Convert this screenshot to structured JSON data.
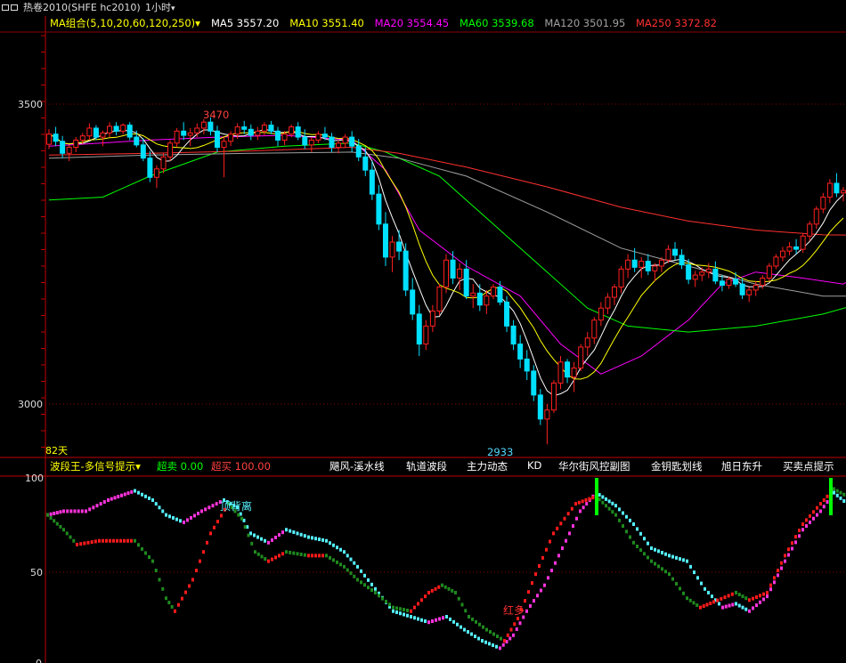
{
  "titlebar": {
    "symbol_title": "热卷2010(SHFE hc2010)",
    "period": "1小时",
    "period_caret": "▾"
  },
  "ma_legend": {
    "combo": "MA组合(5,10,20,60,120,250)",
    "caret": "▾",
    "items": [
      {
        "label": "MA5 3557.20",
        "color": "#ffffff"
      },
      {
        "label": "MA10 3551.40",
        "color": "#ffff00"
      },
      {
        "label": "MA20 3554.45",
        "color": "#ff00ff"
      },
      {
        "label": "MA60 3539.68",
        "color": "#00ff00"
      },
      {
        "label": "MA120 3501.95",
        "color": "#a0a0a0"
      },
      {
        "label": "MA250 3372.82",
        "color": "#ff3030"
      }
    ]
  },
  "price_axis": {
    "labels": [
      "3500",
      "3000"
    ]
  },
  "annotations": {
    "high": "3470",
    "low": "2933",
    "days": "82天"
  },
  "indicator": {
    "name": "波段王-多信号提示",
    "caret": "▾",
    "oversold": "超卖 0.00",
    "overbought": "超买 100.00",
    "axis_labels": [
      "100",
      "50",
      "0"
    ],
    "marks": {
      "top_divergence": "顶背离",
      "red": "红多"
    }
  },
  "tabs": [
    "飓风-溪水线",
    "轨道波段",
    "主力动态",
    "KD",
    "华尔街风控副图",
    "金钥匙划线",
    "旭日东升",
    "买卖点提示"
  ],
  "colors": {
    "up": "#ff2020",
    "down": "#00e0ff",
    "grid": "#8a0000",
    "axis": "#c00000",
    "text_red": "#ff4040",
    "magenta": "#ff33dd",
    "green": "#1f8a1f",
    "cyan": "#55f0ff"
  },
  "chart_data": {
    "type": "candlestick",
    "interval": "1 hour",
    "ylim": [
      2900,
      3650
    ],
    "candles": [
      [
        3433,
        3458,
        3425,
        3450
      ],
      [
        3450,
        3462,
        3430,
        3438
      ],
      [
        3438,
        3447,
        3410,
        3418
      ],
      [
        3418,
        3432,
        3405,
        3428
      ],
      [
        3428,
        3445,
        3420,
        3440
      ],
      [
        3440,
        3452,
        3433,
        3447
      ],
      [
        3447,
        3468,
        3440,
        3460
      ],
      [
        3460,
        3465,
        3440,
        3445
      ],
      [
        3445,
        3456,
        3430,
        3452
      ],
      [
        3452,
        3470,
        3445,
        3463
      ],
      [
        3463,
        3470,
        3448,
        3455
      ],
      [
        3455,
        3468,
        3450,
        3465
      ],
      [
        3465,
        3470,
        3440,
        3445
      ],
      [
        3445,
        3456,
        3428,
        3432
      ],
      [
        3432,
        3443,
        3405,
        3410
      ],
      [
        3410,
        3422,
        3370,
        3378
      ],
      [
        3378,
        3398,
        3360,
        3392
      ],
      [
        3392,
        3418,
        3385,
        3412
      ],
      [
        3412,
        3440,
        3405,
        3435
      ],
      [
        3435,
        3460,
        3428,
        3455
      ],
      [
        3455,
        3470,
        3440,
        3448
      ],
      [
        3448,
        3460,
        3430,
        3452
      ],
      [
        3452,
        3468,
        3445,
        3460
      ],
      [
        3460,
        3475,
        3450,
        3470
      ],
      [
        3470,
        3478,
        3448,
        3455
      ],
      [
        3455,
        3464,
        3420,
        3428
      ],
      [
        3428,
        3445,
        3378,
        3438
      ],
      [
        3438,
        3455,
        3430,
        3450
      ],
      [
        3450,
        3468,
        3442,
        3462
      ],
      [
        3462,
        3472,
        3450,
        3458
      ],
      [
        3458,
        3466,
        3440,
        3448
      ],
      [
        3448,
        3462,
        3440,
        3455
      ],
      [
        3455,
        3470,
        3448,
        3465
      ],
      [
        3465,
        3472,
        3450,
        3455
      ],
      [
        3455,
        3462,
        3430,
        3440
      ],
      [
        3440,
        3455,
        3432,
        3450
      ],
      [
        3450,
        3466,
        3445,
        3462
      ],
      [
        3462,
        3470,
        3440,
        3445
      ],
      [
        3445,
        3458,
        3425,
        3432
      ],
      [
        3432,
        3445,
        3420,
        3440
      ],
      [
        3440,
        3455,
        3435,
        3450
      ],
      [
        3450,
        3462,
        3440,
        3445
      ],
      [
        3445,
        3452,
        3420,
        3428
      ],
      [
        3428,
        3440,
        3418,
        3435
      ],
      [
        3435,
        3450,
        3428,
        3445
      ],
      [
        3445,
        3455,
        3420,
        3430
      ],
      [
        3430,
        3442,
        3405,
        3412
      ],
      [
        3412,
        3428,
        3380,
        3390
      ],
      [
        3390,
        3405,
        3340,
        3350
      ],
      [
        3350,
        3365,
        3290,
        3300
      ],
      [
        3300,
        3320,
        3230,
        3245
      ],
      [
        3245,
        3280,
        3220,
        3270
      ],
      [
        3270,
        3290,
        3240,
        3255
      ],
      [
        3255,
        3268,
        3180,
        3190
      ],
      [
        3190,
        3210,
        3140,
        3150
      ],
      [
        3150,
        3165,
        3080,
        3100
      ],
      [
        3100,
        3140,
        3090,
        3130
      ],
      [
        3130,
        3165,
        3120,
        3155
      ],
      [
        3155,
        3200,
        3148,
        3195
      ],
      [
        3195,
        3250,
        3185,
        3240
      ],
      [
        3240,
        3255,
        3200,
        3210
      ],
      [
        3210,
        3235,
        3190,
        3225
      ],
      [
        3225,
        3240,
        3175,
        3180
      ],
      [
        3180,
        3200,
        3160,
        3185
      ],
      [
        3185,
        3200,
        3155,
        3165
      ],
      [
        3165,
        3190,
        3150,
        3180
      ],
      [
        3180,
        3200,
        3175,
        3195
      ],
      [
        3195,
        3205,
        3165,
        3170
      ],
      [
        3170,
        3180,
        3120,
        3130
      ],
      [
        3130,
        3140,
        3090,
        3100
      ],
      [
        3100,
        3115,
        3060,
        3075
      ],
      [
        3075,
        3090,
        3040,
        3055
      ],
      [
        3055,
        3065,
        3005,
        3015
      ],
      [
        3015,
        3025,
        2965,
        2975
      ],
      [
        2975,
        3000,
        2933,
        2990
      ],
      [
        2990,
        3040,
        2985,
        3035
      ],
      [
        3035,
        3080,
        3025,
        3070
      ],
      [
        3070,
        3075,
        3035,
        3045
      ],
      [
        3045,
        3070,
        3020,
        3060
      ],
      [
        3060,
        3100,
        3055,
        3095
      ],
      [
        3095,
        3120,
        3080,
        3110
      ],
      [
        3110,
        3145,
        3100,
        3140
      ],
      [
        3140,
        3170,
        3130,
        3160
      ],
      [
        3160,
        3185,
        3150,
        3178
      ],
      [
        3178,
        3200,
        3165,
        3195
      ],
      [
        3195,
        3230,
        3185,
        3225
      ],
      [
        3225,
        3250,
        3210,
        3240
      ],
      [
        3240,
        3260,
        3220,
        3228
      ],
      [
        3228,
        3245,
        3210,
        3238
      ],
      [
        3238,
        3250,
        3215,
        3222
      ],
      [
        3222,
        3235,
        3205,
        3230
      ],
      [
        3230,
        3245,
        3220,
        3240
      ],
      [
        3240,
        3265,
        3235,
        3258
      ],
      [
        3258,
        3270,
        3240,
        3248
      ],
      [
        3248,
        3258,
        3225,
        3232
      ],
      [
        3232,
        3242,
        3200,
        3208
      ],
      [
        3208,
        3222,
        3195,
        3215
      ],
      [
        3215,
        3228,
        3205,
        3220
      ],
      [
        3220,
        3235,
        3210,
        3225
      ],
      [
        3225,
        3238,
        3200,
        3205
      ],
      [
        3205,
        3215,
        3188,
        3198
      ],
      [
        3198,
        3212,
        3192,
        3208
      ],
      [
        3208,
        3220,
        3195,
        3200
      ],
      [
        3200,
        3210,
        3175,
        3182
      ],
      [
        3182,
        3195,
        3170,
        3190
      ],
      [
        3190,
        3205,
        3180,
        3198
      ],
      [
        3198,
        3215,
        3192,
        3210
      ],
      [
        3210,
        3235,
        3205,
        3230
      ],
      [
        3230,
        3250,
        3225,
        3245
      ],
      [
        3245,
        3262,
        3238,
        3255
      ],
      [
        3255,
        3270,
        3248,
        3262
      ],
      [
        3262,
        3275,
        3250,
        3258
      ],
      [
        3258,
        3285,
        3252,
        3280
      ],
      [
        3280,
        3305,
        3272,
        3300
      ],
      [
        3300,
        3330,
        3292,
        3325
      ],
      [
        3325,
        3352,
        3318,
        3345
      ],
      [
        3345,
        3375,
        3335,
        3368
      ],
      [
        3368,
        3385,
        3345,
        3352
      ],
      [
        3352,
        3362,
        3338,
        3356
      ]
    ],
    "ma_series": [
      {
        "name": "MA20",
        "color": "#ff00ff",
        "points": [
          [
            0,
            3430
          ],
          [
            15,
            3440
          ],
          [
            25,
            3445
          ],
          [
            35,
            3448
          ],
          [
            45,
            3440
          ],
          [
            50,
            3390
          ],
          [
            55,
            3290
          ],
          [
            62,
            3230
          ],
          [
            70,
            3180
          ],
          [
            76,
            3100
          ],
          [
            82,
            3050
          ],
          [
            88,
            3080
          ],
          [
            95,
            3140
          ],
          [
            100,
            3200
          ],
          [
            105,
            3220
          ],
          [
            112,
            3210
          ],
          [
            118,
            3200
          ],
          [
            124,
            3240
          ],
          [
            126,
            3270
          ]
        ]
      },
      {
        "name": "MA60",
        "color": "#00ff00",
        "points": [
          [
            0,
            3340
          ],
          [
            8,
            3345
          ],
          [
            15,
            3380
          ],
          [
            25,
            3420
          ],
          [
            35,
            3430
          ],
          [
            45,
            3435
          ],
          [
            50,
            3420
          ],
          [
            58,
            3380
          ],
          [
            66,
            3300
          ],
          [
            74,
            3220
          ],
          [
            80,
            3160
          ],
          [
            86,
            3130
          ],
          [
            95,
            3120
          ],
          [
            105,
            3130
          ],
          [
            115,
            3150
          ],
          [
            126,
            3185
          ]
        ]
      },
      {
        "name": "MA120",
        "color": "#a0a0a0",
        "points": [
          [
            0,
            3410
          ],
          [
            15,
            3415
          ],
          [
            30,
            3418
          ],
          [
            45,
            3420
          ],
          [
            52,
            3410
          ],
          [
            62,
            3380
          ],
          [
            74,
            3320
          ],
          [
            85,
            3260
          ],
          [
            95,
            3230
          ],
          [
            105,
            3200
          ],
          [
            115,
            3180
          ],
          [
            126,
            3180
          ]
        ]
      },
      {
        "name": "MA250",
        "color": "#ff3030",
        "points": [
          [
            0,
            3415
          ],
          [
            15,
            3418
          ],
          [
            30,
            3422
          ],
          [
            45,
            3428
          ],
          [
            52,
            3418
          ],
          [
            62,
            3395
          ],
          [
            74,
            3362
          ],
          [
            85,
            3328
          ],
          [
            95,
            3305
          ],
          [
            105,
            3290
          ],
          [
            115,
            3282
          ],
          [
            126,
            3281
          ]
        ]
      }
    ]
  }
}
